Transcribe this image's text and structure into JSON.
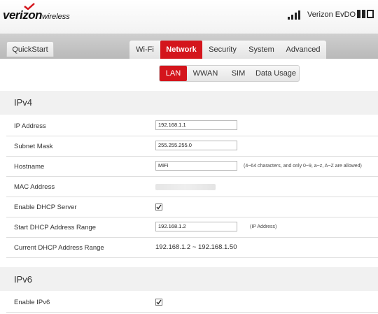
{
  "header": {
    "brand": "verizon",
    "brand_suffix": "wireless",
    "carrier": "Verizon EvDO",
    "icons": {
      "signal": "signal-bars-icon",
      "battery": "battery-icon",
      "brand_check": "check-mark-icon"
    },
    "accent_color": "#d4151c"
  },
  "nav": {
    "quickstart_label": "QuickStart",
    "main_tabs": [
      {
        "label": "Wi-Fi",
        "active": false
      },
      {
        "label": "Network",
        "active": true
      },
      {
        "label": "Security",
        "active": false
      },
      {
        "label": "System",
        "active": false
      },
      {
        "label": "Advanced",
        "active": false
      }
    ],
    "sub_tabs": [
      {
        "label": "LAN",
        "active": true
      },
      {
        "label": "WWAN",
        "active": false
      },
      {
        "label": "SIM",
        "active": false
      },
      {
        "label": "Data Usage",
        "active": false
      }
    ]
  },
  "ipv4": {
    "title": "IPv4",
    "ip_address": {
      "label": "IP Address",
      "value": "192.168.1.1"
    },
    "subnet_mask": {
      "label": "Subnet Mask",
      "value": "255.255.255.0"
    },
    "hostname": {
      "label": "Hostname",
      "value": "MiFi",
      "hint": "(4~64 characters, and only 0~9, a~z, A~Z are allowed)"
    },
    "mac_address": {
      "label": "MAC Address"
    },
    "enable_dhcp": {
      "label": "Enable DHCP Server",
      "checked": true
    },
    "start_dhcp": {
      "label": "Start DHCP Address Range",
      "value": "192.168.1.2",
      "hint": "(IP Address)"
    },
    "current_dhcp": {
      "label": "Current DHCP Address Range",
      "value": "192.168.1.2 ~ 192.168.1.50"
    }
  },
  "ipv6": {
    "title": "IPv6",
    "enable_ipv6": {
      "label": "Enable IPv6",
      "checked": true
    }
  }
}
